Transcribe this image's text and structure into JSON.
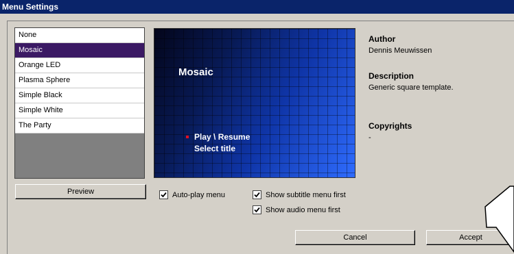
{
  "window": {
    "title": "Menu Settings"
  },
  "themes": {
    "items": [
      "None",
      "Mosaic",
      "Orange LED",
      "Plasma Sphere",
      "Simple Black",
      "Simple White",
      "The Party"
    ],
    "selected": "Mosaic"
  },
  "preview_button": "Preview",
  "preview": {
    "title": "Mosaic",
    "menu_items": [
      "Play \\ Resume",
      "Select title"
    ],
    "bullet_color": "#e01020"
  },
  "options": {
    "autoplay": {
      "label": "Auto-play menu",
      "checked": true
    },
    "subtitle_first": {
      "label": "Show subtitle menu first",
      "checked": true
    },
    "audio_first": {
      "label": "Show audio menu first",
      "checked": true
    }
  },
  "info": {
    "author_label": "Author",
    "author": "Dennis Meuwissen",
    "description_label": "Description",
    "description": "Generic square template.",
    "copyrights_label": "Copyrights",
    "copyrights": "-"
  },
  "buttons": {
    "cancel": "Cancel",
    "accept": "Accept"
  },
  "colors": {
    "titlebar": "#0a246a",
    "selection": "#3b1a64",
    "face": "#d4d0c8"
  },
  "icons": {
    "checkbox": "checkmark-icon",
    "cursor": "mouse-pointer-icon"
  }
}
